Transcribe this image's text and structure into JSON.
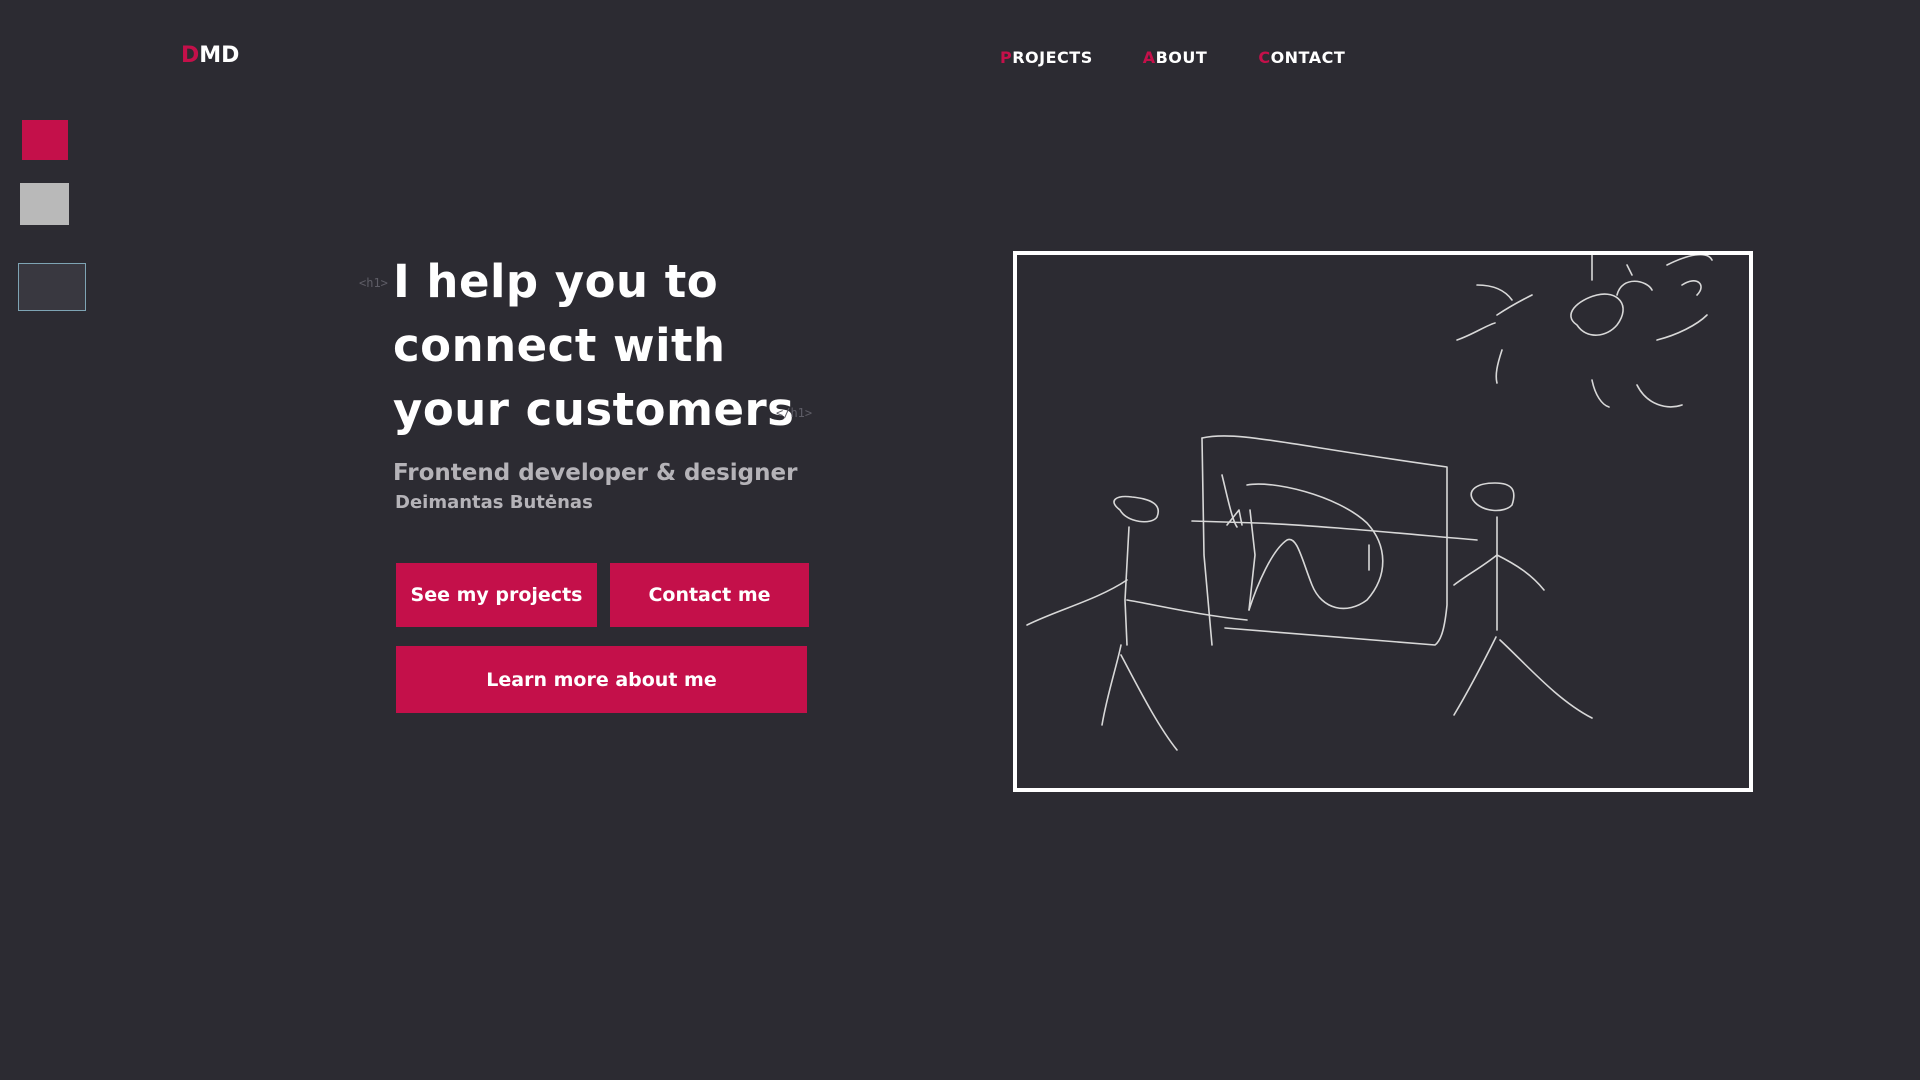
{
  "logo": {
    "first": "D",
    "rest": "MD"
  },
  "nav": {
    "projects": {
      "first": "P",
      "rest": "ROJECTS"
    },
    "about": {
      "first": "A",
      "rest": "BOUT"
    },
    "contact": {
      "first": "C",
      "rest": "ONTACT"
    }
  },
  "hero": {
    "tag_open": "<h1>",
    "tag_close": "</h1>",
    "headline_line1": "I help you to",
    "headline_line2": "connect with",
    "headline_line3": "your customers",
    "subtitle": "Frontend developer & designer",
    "name": "Deimantas Butėnas"
  },
  "buttons": {
    "projects": "See my projects",
    "contact": "Contact me",
    "learn": "Learn more about me"
  },
  "colors": {
    "background": "#2c2b32",
    "accent": "#c4104a",
    "text": "#ffffff",
    "muted": "#b5b3b8"
  }
}
